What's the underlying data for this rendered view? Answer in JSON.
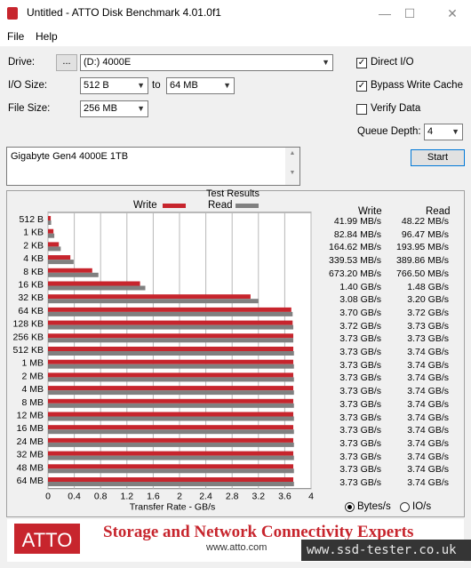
{
  "window": {
    "title": "Untitled - ATTO Disk Benchmark 4.01.0f1",
    "minimize": "—",
    "maximize": "☐",
    "close": "✕"
  },
  "menu": {
    "file": "File",
    "help": "Help"
  },
  "controls": {
    "drive_label": "Drive:",
    "browse_label": "...",
    "drive_value": "(D:) 4000E",
    "io_size_label": "I/O Size:",
    "io_from": "512 B",
    "io_to_label": "to",
    "io_to": "64 MB",
    "file_size_label": "File Size:",
    "file_size": "256 MB",
    "direct_io": {
      "label": "Direct I/O",
      "checked": true
    },
    "bypass_cache": {
      "label": "Bypass Write Cache",
      "checked": true
    },
    "verify": {
      "label": "Verify Data",
      "checked": false
    },
    "queue_depth_label": "Queue Depth:",
    "queue_depth": "4",
    "start_label": "Start",
    "description": "Gigabyte Gen4 4000E 1TB"
  },
  "results": {
    "title": "Test Results",
    "write_header": "Write",
    "read_header": "Read",
    "units": {
      "bytes": "Bytes/s",
      "io": "IO/s",
      "selected": "bytes"
    },
    "write_values": [
      "41.99 MB/s",
      "82.84 MB/s",
      "164.62 MB/s",
      "339.53 MB/s",
      "673.20 MB/s",
      "1.40 GB/s",
      "3.08 GB/s",
      "3.70 GB/s",
      "3.72 GB/s",
      "3.73 GB/s",
      "3.73 GB/s",
      "3.73 GB/s",
      "3.73 GB/s",
      "3.73 GB/s",
      "3.73 GB/s",
      "3.73 GB/s",
      "3.73 GB/s",
      "3.73 GB/s",
      "3.73 GB/s",
      "3.73 GB/s",
      "3.73 GB/s"
    ],
    "read_values": [
      "48.22 MB/s",
      "96.47 MB/s",
      "193.95 MB/s",
      "389.86 MB/s",
      "766.50 MB/s",
      "1.48 GB/s",
      "3.20 GB/s",
      "3.72 GB/s",
      "3.73 GB/s",
      "3.73 GB/s",
      "3.74 GB/s",
      "3.74 GB/s",
      "3.74 GB/s",
      "3.74 GB/s",
      "3.74 GB/s",
      "3.74 GB/s",
      "3.74 GB/s",
      "3.74 GB/s",
      "3.74 GB/s",
      "3.74 GB/s",
      "3.74 GB/s"
    ]
  },
  "chart_data": {
    "type": "bar",
    "orientation": "horizontal",
    "categories": [
      "512 B",
      "1 KB",
      "2 KB",
      "4 KB",
      "8 KB",
      "16 KB",
      "32 KB",
      "64 KB",
      "128 KB",
      "256 KB",
      "512 KB",
      "1 MB",
      "2 MB",
      "4 MB",
      "8 MB",
      "12 MB",
      "16 MB",
      "24 MB",
      "32 MB",
      "48 MB",
      "64 MB"
    ],
    "series": [
      {
        "name": "Write",
        "color": "#c7252d",
        "values": [
          0.042,
          0.083,
          0.165,
          0.34,
          0.673,
          1.4,
          3.08,
          3.7,
          3.72,
          3.73,
          3.73,
          3.73,
          3.73,
          3.73,
          3.73,
          3.73,
          3.73,
          3.73,
          3.73,
          3.73,
          3.73
        ]
      },
      {
        "name": "Read",
        "color": "#808080",
        "values": [
          0.048,
          0.096,
          0.194,
          0.39,
          0.767,
          1.48,
          3.2,
          3.72,
          3.73,
          3.73,
          3.74,
          3.74,
          3.74,
          3.74,
          3.74,
          3.74,
          3.74,
          3.74,
          3.74,
          3.74,
          3.74
        ]
      }
    ],
    "xticks": [
      "0",
      "0.4",
      "0.8",
      "1.2",
      "1.6",
      "2",
      "2.4",
      "2.8",
      "3.2",
      "3.6",
      "4"
    ],
    "xlim": [
      0,
      4
    ],
    "title": "Test Results",
    "xlabel": "Transfer Rate - GB/s",
    "legend": "top-center",
    "grid": true
  },
  "banner": {
    "brand": "ATTO",
    "tagline": "Storage and Network Connectivity Experts",
    "url": "www.atto.com",
    "brand_color": "#c7252d"
  },
  "watermark": "www.ssd-tester.co.uk"
}
